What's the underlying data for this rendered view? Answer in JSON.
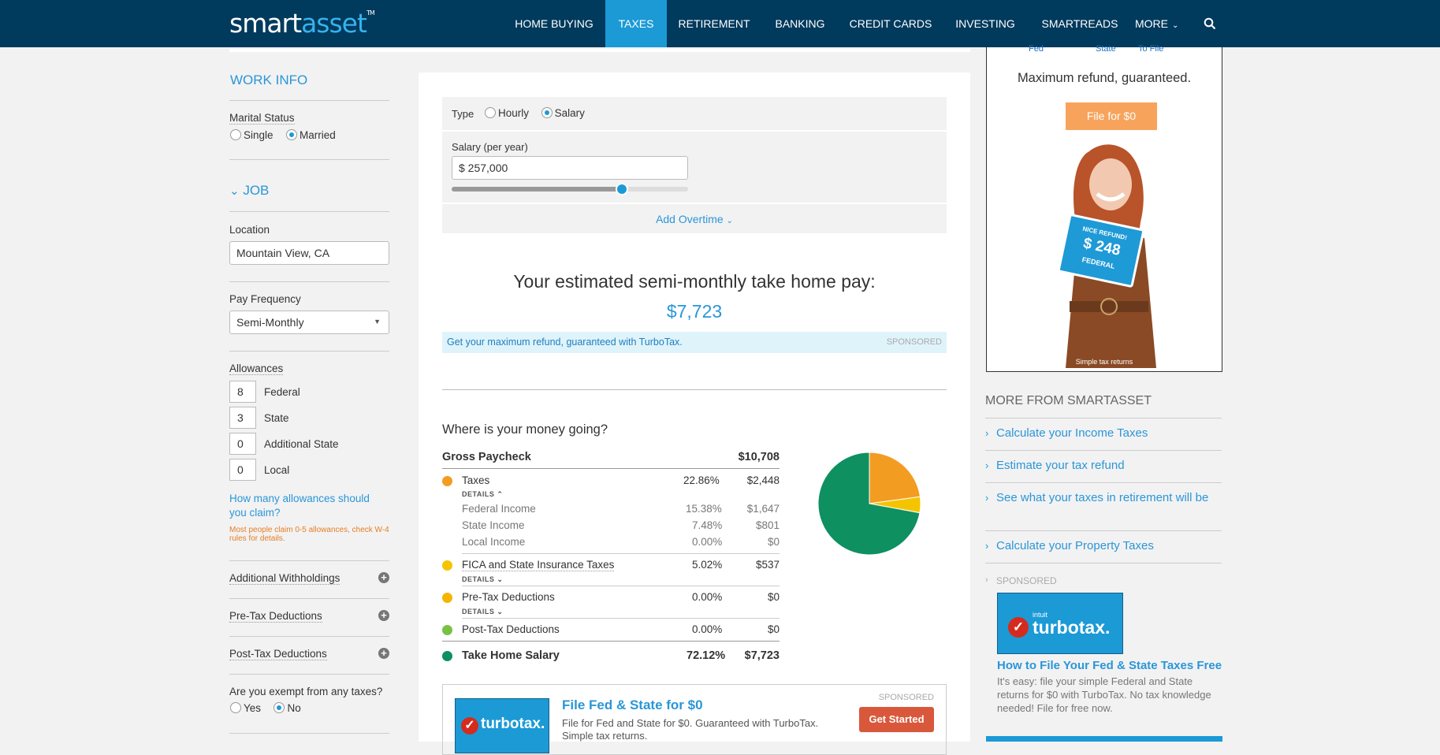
{
  "nav": {
    "logo_smart": "smart",
    "logo_asset": "asset",
    "logo_tm": "TM",
    "items": [
      {
        "label": "HOME BUYING"
      },
      {
        "label": "TAXES"
      },
      {
        "label": "RETIREMENT"
      },
      {
        "label": "BANKING"
      },
      {
        "label": "CREDIT CARDS"
      },
      {
        "label": "INVESTING"
      },
      {
        "label": "SMARTREADS"
      },
      {
        "label": "MORE"
      }
    ],
    "active_item": "TAXES"
  },
  "sidebar": {
    "work_info_title": "WORK INFO",
    "marital_status_label": "Marital Status",
    "marital_options": [
      "Single",
      "Married"
    ],
    "marital_selected": "Married",
    "job_title": "JOB",
    "location_label": "Location",
    "location_value": "Mountain View, CA",
    "pay_frequency_label": "Pay Frequency",
    "pay_frequency_value": "Semi-Monthly",
    "allowances_label": "Allowances",
    "allowances": [
      {
        "value": "8",
        "name": "Federal"
      },
      {
        "value": "3",
        "name": "State"
      },
      {
        "value": "0",
        "name": "Additional State"
      },
      {
        "value": "0",
        "name": "Local"
      }
    ],
    "allowance_help_link": "How many allowances should you claim?",
    "allowance_note": "Most people claim 0-5 allowances, check W-4 rules for details.",
    "additional_withholdings": "Additional Withholdings",
    "pre_tax_deductions": "Pre-Tax Deductions",
    "post_tax_deductions": "Post-Tax Deductions",
    "exempt_question": "Are you exempt from any taxes?",
    "exempt_options": [
      "Yes",
      "No"
    ],
    "exempt_selected": "No"
  },
  "main": {
    "type_label": "Type",
    "type_options": [
      "Hourly",
      "Salary"
    ],
    "type_selected": "Salary",
    "salary_label": "Salary (per year)",
    "salary_value": "$ 257,000",
    "salary_slider_fraction": 0.72,
    "add_overtime": "Add Overtime",
    "estimate_heading": "Your estimated semi-monthly take home pay:",
    "take_home": "$7,723",
    "turbotax_banner": "Get your maximum refund, guaranteed with TurboTax.",
    "sponsored": "SPONSORED",
    "where_heading": "Where is your money going?",
    "gross_label": "Gross Paycheck",
    "gross_value": "$10,708",
    "details_label": "DETAILS",
    "rows": [
      {
        "name": "Taxes",
        "pct": "22.86%",
        "amount": "$2,448",
        "color": "#f39c22"
      },
      {
        "name": "FICA and State Insurance Taxes",
        "pct": "5.02%",
        "amount": "$537",
        "color": "#f5c400"
      },
      {
        "name": "Pre-Tax Deductions",
        "pct": "0.00%",
        "amount": "$0",
        "color": "#f5b400"
      },
      {
        "name": "Post-Tax Deductions",
        "pct": "0.00%",
        "amount": "$0",
        "color": "#7ac143"
      }
    ],
    "tax_breakdown": [
      {
        "name": "Federal Income",
        "pct": "15.38%",
        "amount": "$1,647"
      },
      {
        "name": "State Income",
        "pct": "7.48%",
        "amount": "$801"
      },
      {
        "name": "Local Income",
        "pct": "0.00%",
        "amount": "$0"
      }
    ],
    "take_home_label": "Take Home Salary",
    "take_home_pct": "72.12%",
    "take_home_value": "$7,723",
    "take_home_color": "#0e9060",
    "promo_title": "File Fed & State for $0",
    "promo_text": "File for Fed and State for $0. Guaranteed with TurboTax.",
    "promo_text2": "Simple tax returns.",
    "promo_sponsored": "SPONSORED",
    "promo_button": "Get Started",
    "promo_logo": "turbotax."
  },
  "chart_data": {
    "type": "pie",
    "categories": [
      "Taxes",
      "FICA and State Insurance Taxes",
      "Pre-Tax Deductions",
      "Post-Tax Deductions",
      "Take Home Salary"
    ],
    "values": [
      22.86,
      5.02,
      0.0,
      0.0,
      72.12
    ],
    "colors": [
      "#f39c22",
      "#f5c400",
      "#f5b400",
      "#7ac143",
      "#0e9060"
    ]
  },
  "right": {
    "ad_tabs": [
      "Fed",
      "State",
      "To File"
    ],
    "ad_headline": "Maximum refund, guaranteed.",
    "ad_button": "File for $0",
    "ad_sign_line1": "NICE REFUND!",
    "ad_sign_line2": "$ 248",
    "ad_sign_line3": "FEDERAL",
    "ad_caption": "Simple tax returns",
    "more_title": "MORE FROM SMARTASSET",
    "links": [
      "Calculate your Income Taxes",
      "Estimate your tax refund",
      "See what your taxes in retirement will be",
      "Calculate your Property Taxes"
    ],
    "sponsored": "SPONSORED",
    "tt_logo_small": "intuit",
    "tt_logo": "turbotax.",
    "tt_title": "How to File Your Fed & State Taxes Free",
    "tt_text": "It's easy: file your simple Federal and State returns for $0 with TurboTax. No tax knowledge needed! File for free now."
  }
}
